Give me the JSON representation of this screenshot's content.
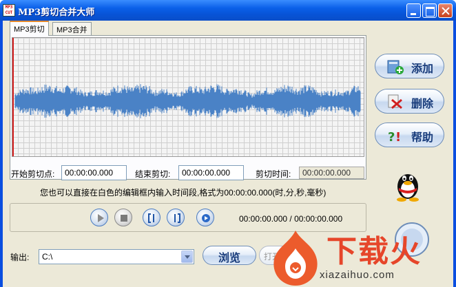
{
  "window": {
    "title": "MP3剪切合并大师",
    "app_icon_text": "MP3 CUT"
  },
  "tabs": [
    {
      "label": "MP3剪切",
      "active": true
    },
    {
      "label": "MP3合并",
      "active": false
    }
  ],
  "cut": {
    "start_label": "开始剪切点:",
    "start_value": "00:00:00.000",
    "end_label": "结束剪切:",
    "end_value": "00:00:00.000",
    "duration_label": "剪切时间:",
    "duration_value": "00:00:00.000",
    "hint": "您也可以直接在白色的编辑框内输入时间段,格式为00:00:00.000(时,分,秒,毫秒)"
  },
  "player": {
    "buttons": [
      "play-icon",
      "stop-icon",
      "mark-start-icon",
      "mark-end-icon",
      "play-selection-icon"
    ],
    "time_display": "00:00:00.000 / 00:00:00.000"
  },
  "side_buttons": {
    "add": "添加",
    "delete": "删除",
    "help": "帮助"
  },
  "output": {
    "label": "输出:",
    "path": "C:\\",
    "browse": "浏览",
    "open": "打开目"
  },
  "watermark": {
    "text": "下载火",
    "url": "xiazaihuo.com"
  },
  "colors": {
    "titlebar": "#0a5fe8",
    "waveform": "#4a82c6",
    "cursor": "#d62020",
    "watermark": "#e6462a"
  }
}
